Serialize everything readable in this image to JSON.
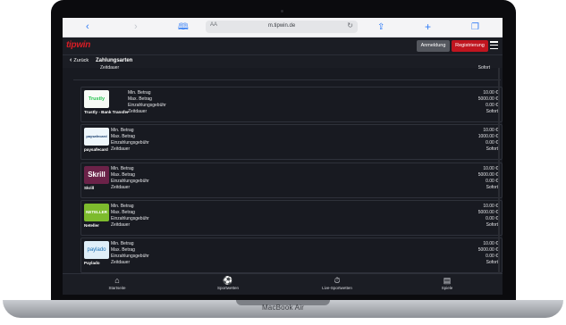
{
  "device": {
    "label": "MacBook Air"
  },
  "browser": {
    "url": "m.tipwin.de",
    "text_size_label": "AA",
    "icons": [
      "back-chevron-icon",
      "forward-chevron-icon",
      "bookmarks-book-icon",
      "share-icon",
      "new-tab-plus-icon",
      "tabs-icon",
      "reload-icon"
    ]
  },
  "header": {
    "logo": "tipwin",
    "login_label": "Anmeldung",
    "register_label": "Registrierung",
    "brand_color": "#c0151f"
  },
  "subheader": {
    "back_label": "Zurück",
    "title": "Zahlungsarten"
  },
  "partial_item": {
    "label": "Zeitdauer",
    "value": "Sofort"
  },
  "fee_labels": {
    "min": "Min. Betrag",
    "max": "Max. Betrag",
    "fee": "Einzahlungsgebühr",
    "duration": "Zeitdauer"
  },
  "payment_methods": [
    {
      "name": "Trustly - Bank Transfer",
      "logo": "Trustly",
      "min": "10.00 €",
      "max": "5000.00 €",
      "fee": "0.00 €",
      "duration": "Sofort"
    },
    {
      "name": "paysafecard",
      "logo": "paysafecard",
      "min": "10.00 €",
      "max": "1000.00 €",
      "fee": "0.00 €",
      "duration": "Sofort"
    },
    {
      "name": "Skrill",
      "logo": "Skrill",
      "min": "10.00 €",
      "max": "5000.00 €",
      "fee": "0.00 €",
      "duration": "Sofort"
    },
    {
      "name": "Neteller",
      "logo": "NETELLER",
      "min": "10.00 €",
      "max": "5000.00 €",
      "fee": "0.00 €",
      "duration": "Sofort"
    },
    {
      "name": "Paylado",
      "logo": "paylado",
      "min": "10.00 €",
      "max": "5000.00 €",
      "fee": "0.00 €",
      "duration": "Sofort"
    }
  ],
  "bottom_nav": [
    {
      "label": "Startseite",
      "icon": "home-icon"
    },
    {
      "label": "Sportwetten",
      "icon": "football-icon"
    },
    {
      "label": "Live-Sportwetten",
      "icon": "stopwatch-icon"
    },
    {
      "label": "Spiele",
      "icon": "slot-machine-icon"
    }
  ]
}
